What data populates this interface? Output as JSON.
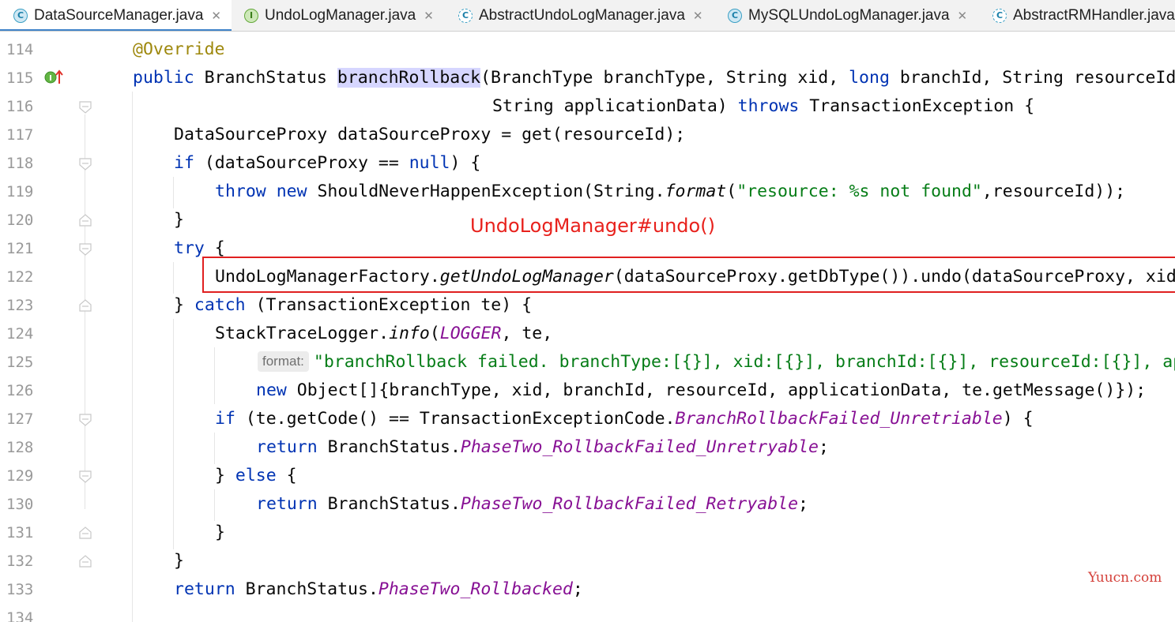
{
  "tabs": [
    {
      "label": "DataSourceManager.java",
      "icon": "class-icon",
      "active": true,
      "closable": true
    },
    {
      "label": "UndoLogManager.java",
      "icon": "interface-icon",
      "active": false,
      "closable": true
    },
    {
      "label": "AbstractUndoLogManager.java",
      "icon": "abstract-class-icon",
      "active": false,
      "closable": true
    },
    {
      "label": "MySQLUndoLogManager.java",
      "icon": "class-icon",
      "active": false,
      "closable": true
    },
    {
      "label": "AbstractRMHandler.java",
      "icon": "abstract-class-icon",
      "active": false,
      "closable": false
    }
  ],
  "gutter": {
    "line_numbers": [
      "114",
      "115",
      "116",
      "117",
      "118",
      "119",
      "120",
      "121",
      "122",
      "123",
      "124",
      "125",
      "126",
      "127",
      "128",
      "129",
      "130",
      "131",
      "132",
      "133",
      "134"
    ],
    "markers": {
      "implements_marker_line": "115",
      "implements_marker_label": "I"
    }
  },
  "code": {
    "l114": {
      "annotation": "@Override"
    },
    "l115": {
      "p1": "public",
      "p2": " BranchStatus ",
      "method": "branchRollback",
      "p3": "(BranchType branchType, String xid, ",
      "p4": "long",
      "p5": " branchId, String resourceId,"
    },
    "l116": {
      "p1": "String applicationData) ",
      "p2": "throws",
      "p3": " TransactionException {"
    },
    "l117": {
      "p1": "DataSourceProxy dataSourceProxy = get(resourceId);"
    },
    "l118": {
      "p1": "if",
      "p2": " (dataSourceProxy == ",
      "p3": "null",
      "p4": ") {"
    },
    "l119": {
      "p1": "throw",
      "p2": " ",
      "p3": "new",
      "p4": " ShouldNeverHappenException(String.",
      "p5": "format",
      "p6": "(",
      "p7": "\"resource: %s not found\"",
      "p8": ",resourceId));"
    },
    "l120": {
      "p1": "}"
    },
    "l121": {
      "p1": "try",
      "p2": " {"
    },
    "l122": {
      "p1": "UndoLogManagerFactory.",
      "p2": "getUndoLogManager",
      "p3": "(dataSourceProxy.getDbType()).undo(dataSourceProxy, xid, branchId);"
    },
    "l123": {
      "p1": "} ",
      "p2": "catch",
      "p3": " (TransactionException te) {"
    },
    "l124": {
      "p1": "StackTraceLogger.",
      "p2": "info",
      "p3": "(",
      "p4": "LOGGER",
      "p5": ", te,"
    },
    "l125": {
      "hint": "format:",
      "p1": "\"branchRollback failed. branchType:[{}], xid:[{}], branchId:[{}], resourceId:[{}], applicationData:[{}]. reason:[{}]\","
    },
    "l126": {
      "p1": "new",
      "p2": " Object[]{branchType, xid, branchId, resourceId, applicationData, te.getMessage()});"
    },
    "l127": {
      "p1": "if",
      "p2": " (te.getCode() == TransactionExceptionCode.",
      "p3": "BranchRollbackFailed_Unretriable",
      "p4": ") {"
    },
    "l128": {
      "p1": "return",
      "p2": " BranchStatus.",
      "p3": "PhaseTwo_RollbackFailed_Unretryable",
      "p4": ";"
    },
    "l129": {
      "p1": "} ",
      "p2": "else",
      "p3": " {"
    },
    "l130": {
      "p1": "return",
      "p2": " BranchStatus.",
      "p3": "PhaseTwo_RollbackFailed_Retryable",
      "p4": ";"
    },
    "l131": {
      "p1": "}"
    },
    "l132": {
      "p1": "}"
    },
    "l133": {
      "p1": "return",
      "p2": " BranchStatus.",
      "p3": "PhaseTwo_Rollbacked",
      "p4": ";"
    }
  },
  "annotation": {
    "label": "UndoLogManager#undo()",
    "color": "#e8211c"
  },
  "watermark": "Yuucn.com",
  "colors": {
    "keyword": "#0033b3",
    "string": "#067d17",
    "annotation": "#9e880d",
    "static_field": "#871094",
    "method_highlight": "#d6d6ff",
    "callout": "#e02020"
  }
}
